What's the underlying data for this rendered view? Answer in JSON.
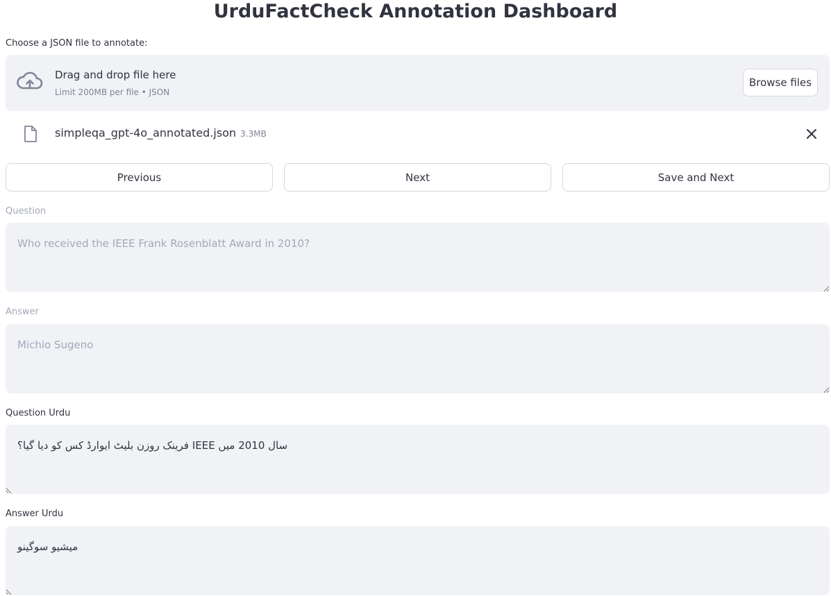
{
  "header": {
    "title": "UrduFactCheck Annotation Dashboard"
  },
  "uploader": {
    "label": "Choose a JSON file to annotate:",
    "drop_text": "Drag and drop file here",
    "limit_text": "Limit 200MB per file • JSON",
    "browse_label": "Browse files",
    "upload_icon": "cloud-upload-icon"
  },
  "uploaded_file": {
    "name": "simpleqa_gpt-4o_annotated.json",
    "size": "3.3MB",
    "file_icon": "file-icon",
    "remove_icon": "close-icon"
  },
  "navigation": {
    "previous_label": "Previous",
    "next_label": "Next",
    "save_next_label": "Save and Next"
  },
  "fields": {
    "question": {
      "label": "Question",
      "value": "Who received the IEEE Frank Rosenblatt Award in 2010?",
      "disabled": true
    },
    "answer": {
      "label": "Answer",
      "value": "Michio Sugeno",
      "disabled": true
    },
    "question_urdu": {
      "label": "Question Urdu",
      "value": "سال 2010 میں IEEE فرینک روزن بلیٹ ایوارڈ کس کو دیا گیا؟",
      "disabled": false
    },
    "answer_urdu": {
      "label": "Answer Urdu",
      "value": "میشیو سوگینو",
      "disabled": false
    }
  },
  "colors": {
    "text": "#31333f",
    "muted": "#808495",
    "disabled_text": "#a3a8b8",
    "field_bg": "#f0f2f6",
    "border": "#d6d6d9"
  }
}
